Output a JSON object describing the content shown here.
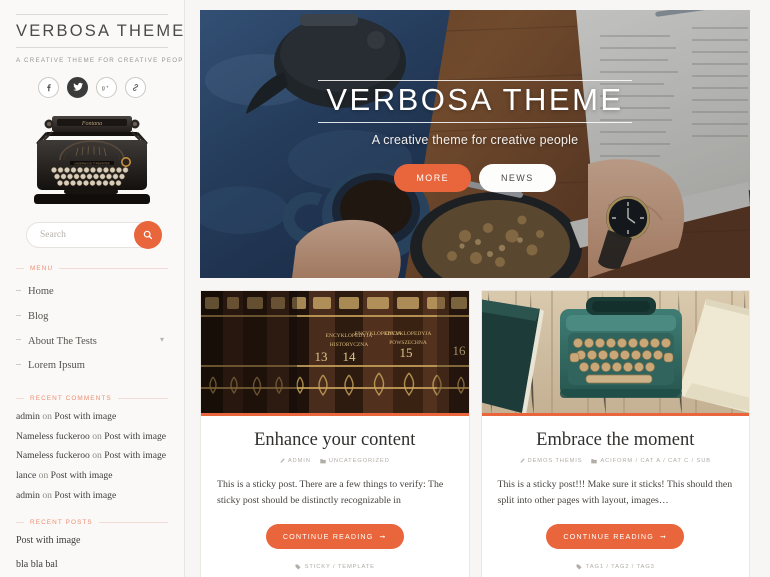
{
  "site": {
    "title": "VERBOSA THEME",
    "tagline": "A CREATIVE THEME FOR CREATIVE PEOPLE",
    "accent_color": "#e9653c",
    "social": [
      {
        "name": "facebook-icon",
        "label": "f"
      },
      {
        "name": "twitter-icon",
        "label": "t"
      },
      {
        "name": "google-plus-icon",
        "label": "g+"
      },
      {
        "name": "link-icon",
        "label": "link"
      }
    ]
  },
  "search": {
    "placeholder": "Search",
    "value": "",
    "button_icon": "search-icon"
  },
  "sidebar": {
    "menu": {
      "title": "MENU",
      "items": [
        {
          "label": "Home",
          "has_submenu": false
        },
        {
          "label": "Blog",
          "has_submenu": false
        },
        {
          "label": "About The Tests",
          "has_submenu": true
        },
        {
          "label": "Lorem Ipsum",
          "has_submenu": false
        }
      ]
    },
    "recent_comments": {
      "title": "RECENT COMMENTS",
      "items": [
        {
          "author": "admin",
          "connector": " on ",
          "post": "Post with image"
        },
        {
          "author": "Nameless fuckeroo",
          "connector": " on ",
          "post": "Post with image"
        },
        {
          "author": "Nameless fuckeroo",
          "connector": " on ",
          "post": "Post with image"
        },
        {
          "author": "lance",
          "connector": " on ",
          "post": "Post with image"
        },
        {
          "author": "admin",
          "connector": " on ",
          "post": "Post with image"
        }
      ]
    },
    "recent_posts": {
      "title": "RECENT POSTS",
      "items": [
        {
          "label": "Post with image"
        },
        {
          "label": "bla bla bal"
        }
      ]
    }
  },
  "hero": {
    "title": "VERBOSA THEME",
    "subtitle": "A creative theme for creative people",
    "primary_button": "MORE",
    "secondary_button": "NEWS"
  },
  "posts": [
    {
      "title": "Enhance your content",
      "author": "ADMIN",
      "category": "UNCATEGORIZED",
      "excerpt": "This is a sticky post. There are a few things to verify: The sticky post should be distinctly recognizable in",
      "cta": "CONTINUE READING",
      "tags": "STICKY / TEMPLATE",
      "image": "antique-books"
    },
    {
      "title": "Embrace the moment",
      "author": "DEMOS THEMIS",
      "category": "ACIFORM / CAT A / CAT C / SUB",
      "excerpt": "This is a sticky post!!! Make sure it sticks! This should then split into other pages with layout, images…",
      "cta": "CONTINUE READING",
      "tags": "TAG1 / TAG2 / TAG3",
      "image": "teal-typewriter"
    }
  ]
}
